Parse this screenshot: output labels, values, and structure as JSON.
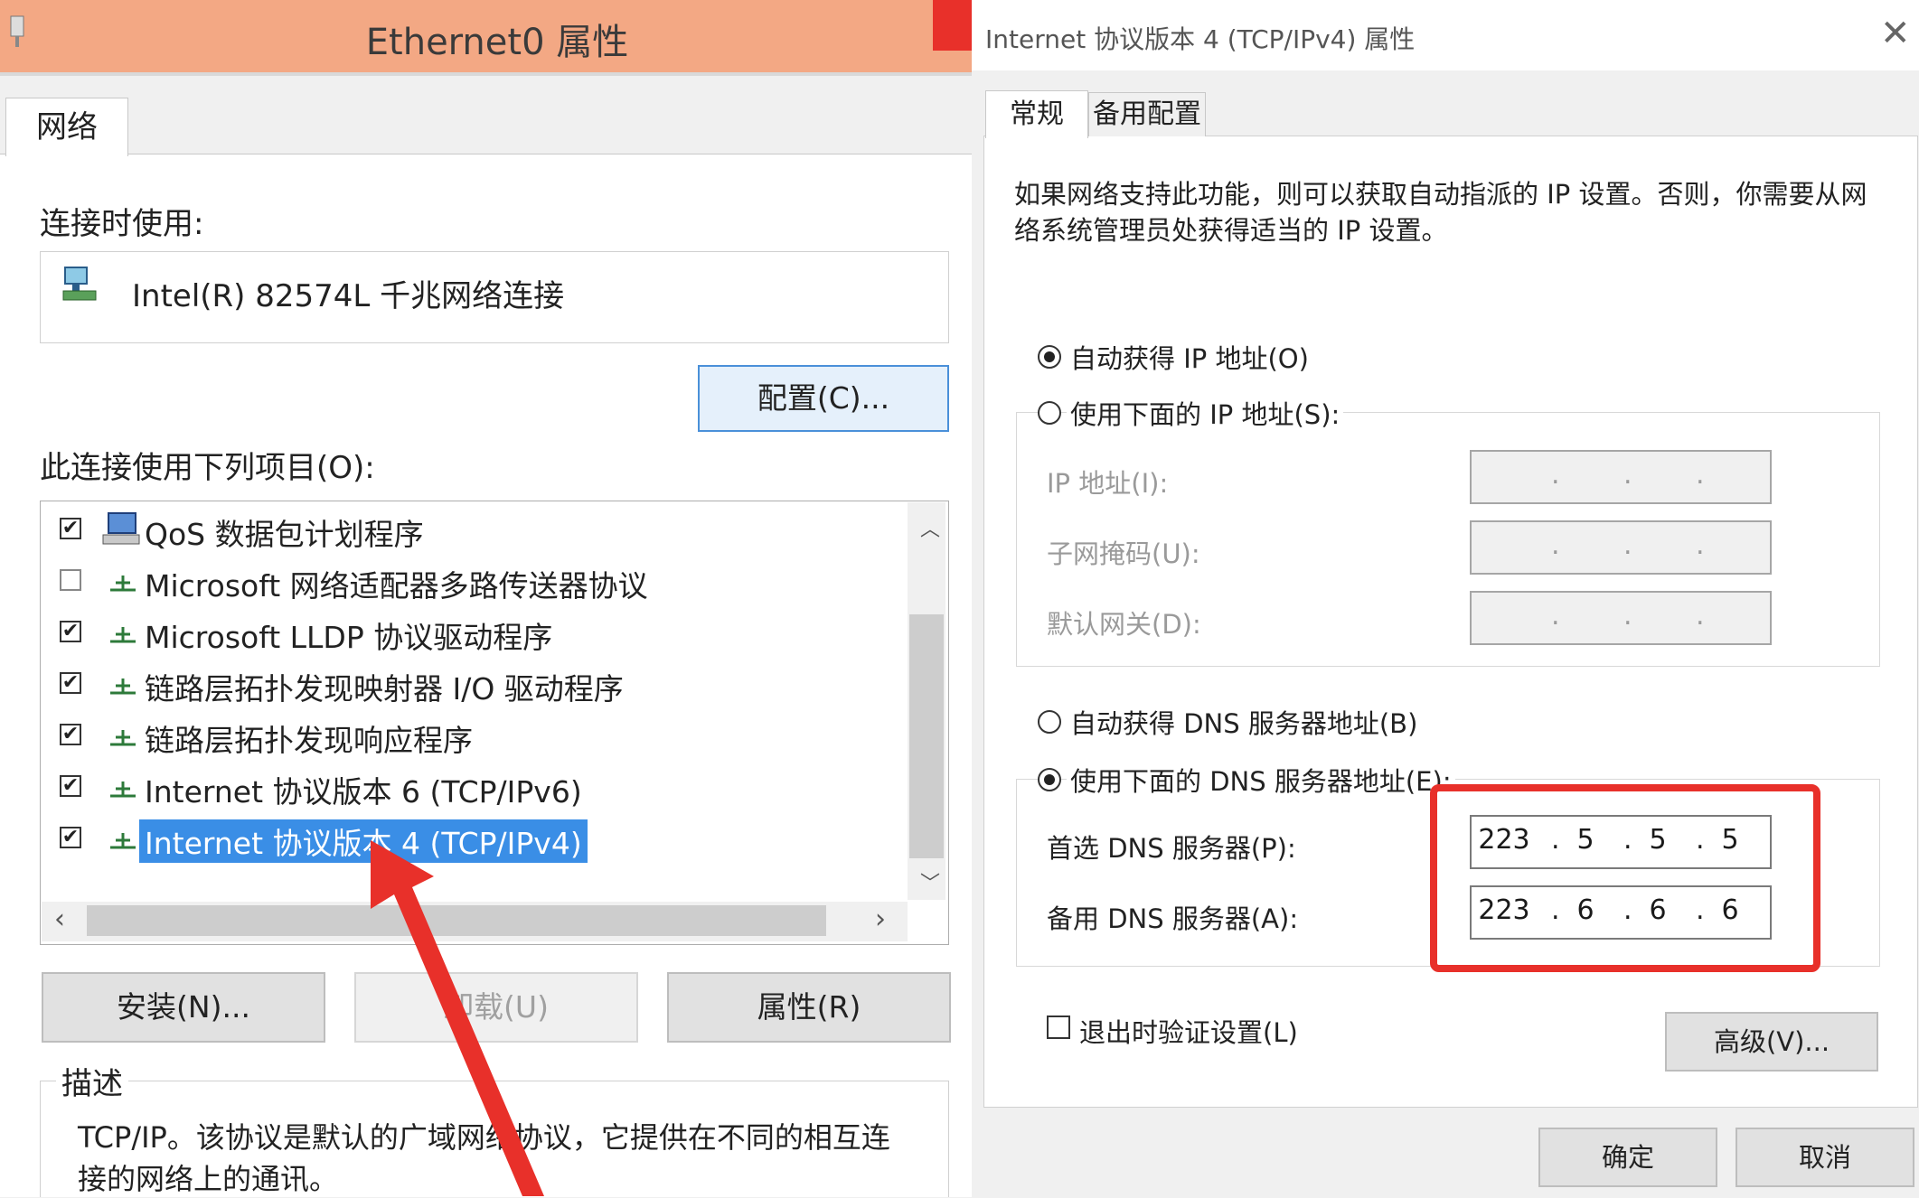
{
  "left": {
    "title": "Ethernet0 属性",
    "tab_label": "网络",
    "connect_using_label": "连接时使用:",
    "adapter_name": "Intel(R) 82574L 千兆网络连接",
    "configure_button": "配置(C)...",
    "items_label": "此连接使用下列项目(O):",
    "items": [
      {
        "label": "QoS 数据包计划程序",
        "checked": true
      },
      {
        "label": "Microsoft 网络适配器多路传送器协议",
        "checked": false
      },
      {
        "label": "Microsoft LLDP 协议驱动程序",
        "checked": true
      },
      {
        "label": "链路层拓扑发现映射器 I/O 驱动程序",
        "checked": true
      },
      {
        "label": "链路层拓扑发现响应程序",
        "checked": true
      },
      {
        "label": "Internet 协议版本 6 (TCP/IPv6)",
        "checked": true
      },
      {
        "label": "Internet 协议版本 4 (TCP/IPv4)",
        "checked": true,
        "selected": true
      }
    ],
    "install_button": "安装(N)...",
    "uninstall_button": "卸载(U)",
    "properties_button": "属性(R)",
    "description_label": "描述",
    "description_text_line1": "TCP/IP。该协议是默认的广域网络协议，它提供在不同的相互连",
    "description_text_line2": "接的网络上的通讯。"
  },
  "right": {
    "title": "Internet 协议版本 4 (TCP/IPv4) 属性",
    "tabs": [
      "常规",
      "备用配置"
    ],
    "intro_line1": "如果网络支持此功能，则可以获取自动指派的 IP 设置。否则，你需要从网",
    "intro_line2": "络系统管理员处获得适当的 IP 设置。",
    "auto_ip_radio": "自动获得 IP 地址(O)",
    "manual_ip_radio": "使用下面的 IP 地址(S):",
    "ip_label": "IP 地址(I):",
    "subnet_label": "子网掩码(U):",
    "gateway_label": "默认网关(D):",
    "auto_dns_radio": "自动获得 DNS 服务器地址(B)",
    "manual_dns_radio": "使用下面的 DNS 服务器地址(E):",
    "preferred_dns_label": "首选 DNS 服务器(P):",
    "preferred_dns": [
      "223",
      "5",
      "5",
      "5"
    ],
    "alternate_dns_label": "备用 DNS 服务器(A):",
    "alternate_dns": [
      "223",
      "6",
      "6",
      "6"
    ],
    "validate_checkbox": "退出时验证设置(L)",
    "advanced_button": "高级(V)...",
    "ok_button": "确定",
    "cancel_button": "取消",
    "ip_auto": true,
    "dns_auto": false
  },
  "colors": {
    "titlebar": "#f3a884",
    "highlight": "#e8302a",
    "selection": "#3a8ee6"
  }
}
